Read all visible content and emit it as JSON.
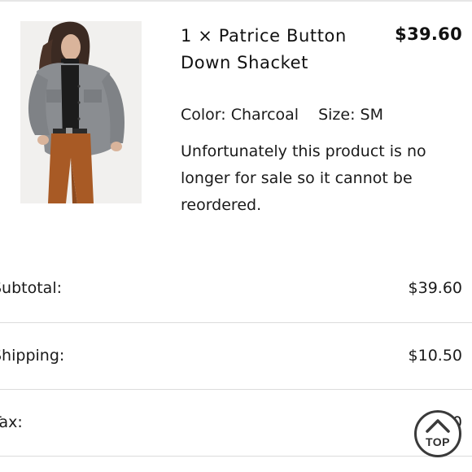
{
  "product": {
    "name": "1 × Patrice Button Down Shacket",
    "price": "$39.60",
    "color_label": "Color:",
    "color_value": "Charcoal",
    "size_label": "Size:",
    "size_value": "SM",
    "notice": "Unfortunately this product is no longer for sale so it cannot be reordered."
  },
  "summary": {
    "subtotal_label": "Subtotal:",
    "subtotal_value": "$39.60",
    "shipping_label": "Shipping:",
    "shipping_value": "$10.50",
    "tax_label": "Tax:",
    "tax_value": "$0.00"
  },
  "scroll_top": {
    "label": "TOP",
    "icon": "chevron-up-icon"
  },
  "colors": {
    "divider": "#dcdcdc",
    "text": "#1a1a1a",
    "jacket": "#8a8d91",
    "pants": "#a85a25"
  }
}
